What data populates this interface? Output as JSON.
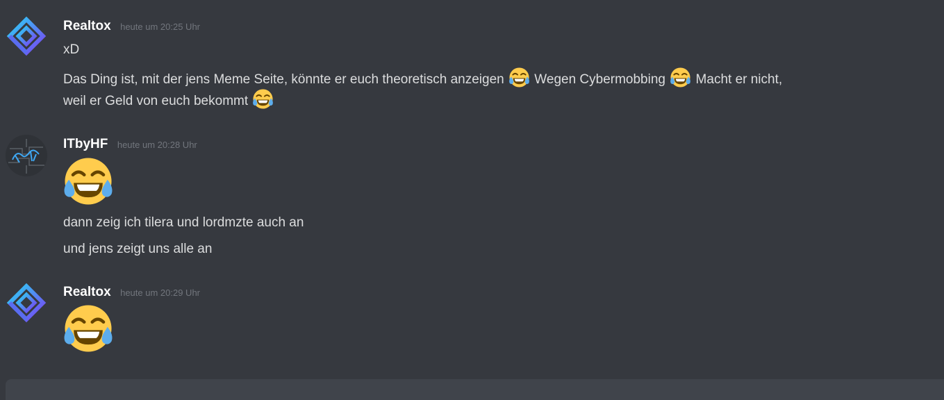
{
  "messages": [
    {
      "username": "Realtox",
      "timestamp": "heute um 20:25 Uhr",
      "avatar_icon": "realtox-diamond-logo-icon",
      "lines": {
        "l1": "xD",
        "l2a": "Das Ding ist, mit der jens Meme Seite, könnte er euch theoretisch anzeigen",
        "l2b": " Wegen Cybermobbing",
        "l2c": "Macht er nicht,",
        "l3a": "weil er Geld von euch bekommt"
      }
    },
    {
      "username": "ITbyHF",
      "timestamp": "heute um 20:28 Uhr",
      "avatar_icon": "itbyhf-logo-icon",
      "lines": {
        "l1": "dann zeig ich tilera und lordmzte auch an",
        "l2": "und jens zeigt uns alle an"
      }
    },
    {
      "username": "Realtox",
      "timestamp": "heute um 20:29 Uhr",
      "avatar_icon": "realtox-diamond-logo-icon"
    }
  ],
  "emoji_name": "joy-emoji-icon",
  "colors": {
    "background": "#36393f",
    "username": "#ffffff",
    "timestamp": "#72767d",
    "text": "#dcddde",
    "input_bar": "#40444b"
  }
}
